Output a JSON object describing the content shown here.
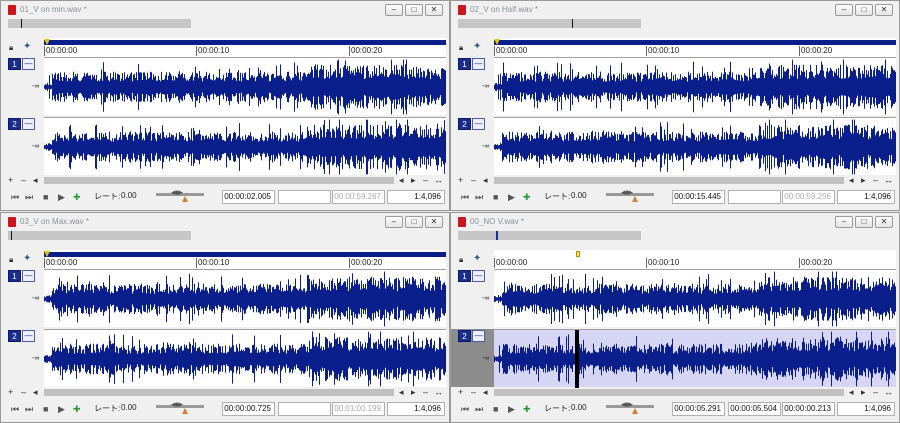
{
  "ruler_labels": [
    "00:00:00",
    "00:00:10",
    "00:00:20"
  ],
  "channel_db_label": "-∞",
  "rate_label": "レート:",
  "rate_value": "0.00",
  "wave_color": "#0a1f8c",
  "selection_color": "#d6d6f4",
  "icons": {
    "lock": "lock-icon",
    "snap": "snap-icon",
    "file": "audio-file-icon",
    "minimize": "minimize-icon",
    "restore": "restore-icon",
    "close": "close-icon"
  },
  "windows": [
    {
      "title": "01_V on min.wav *",
      "channels": [
        {
          "number": "1",
          "selected": false
        },
        {
          "number": "2",
          "selected": false
        }
      ],
      "times": {
        "cursor": "00:00:02.005",
        "selection_length": "",
        "length": "00:00:59.267",
        "zoom": "1:4,096"
      }
    },
    {
      "title": "02_V on Half.wav *",
      "channels": [
        {
          "number": "1",
          "selected": false
        },
        {
          "number": "2",
          "selected": false
        }
      ],
      "times": {
        "cursor": "00:00:15.445",
        "selection_length": "",
        "length": "00:00:59.256",
        "zoom": "1:4,096"
      }
    },
    {
      "title": "03_V on Max.wav *",
      "channels": [
        {
          "number": "1",
          "selected": false
        },
        {
          "number": "2",
          "selected": false
        }
      ],
      "times": {
        "cursor": "00:00:00.725",
        "selection_length": "",
        "length": "00:01:00.199",
        "zoom": "1:4,096"
      }
    },
    {
      "title": "00_NO V.wav *",
      "channels": [
        {
          "number": "1",
          "selected": false
        },
        {
          "number": "2",
          "selected": true
        }
      ],
      "times": {
        "cursor": "00:00:05.291",
        "selection_length": "00:00:05.504",
        "length": "00:00:00.213",
        "zoom": "1:4,096"
      }
    }
  ]
}
